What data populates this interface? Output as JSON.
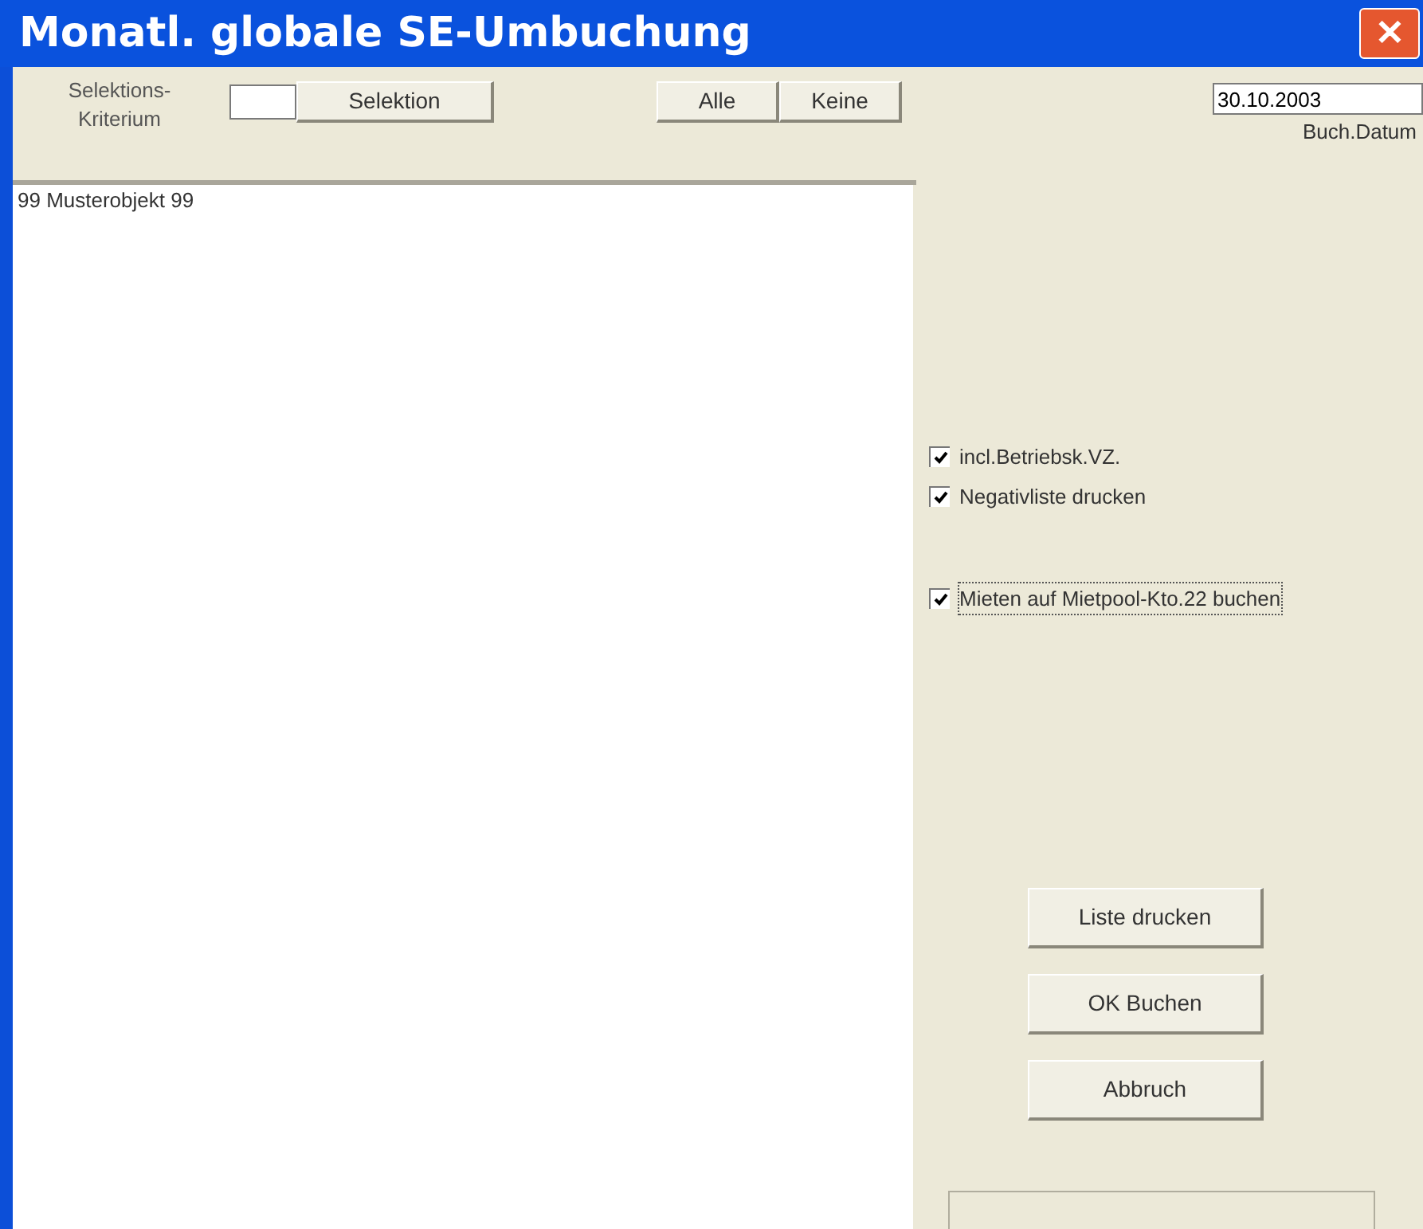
{
  "window": {
    "title": "Monatl. globale SE-Umbuchung",
    "close": "✕"
  },
  "selection": {
    "label": "Selektions-\nKriterium",
    "button": "Selektion"
  },
  "list_buttons": [
    "Alle",
    "Keine"
  ],
  "list": {
    "items": [
      "99 Musterobjekt 99"
    ]
  },
  "date": {
    "value": "30.10.2003",
    "label": "Buch.Datum"
  },
  "options": [
    {
      "label": "incl.Betriebsk.VZ.",
      "checked": true,
      "focused": false
    },
    {
      "label": "Negativliste drucken",
      "checked": true,
      "focused": false
    },
    {
      "label": "Mieten auf Mietpool-Kto.22 buchen",
      "checked": true,
      "focused": true
    }
  ],
  "buttons": [
    "Liste drucken",
    "OK Buchen",
    "Abbruch"
  ]
}
